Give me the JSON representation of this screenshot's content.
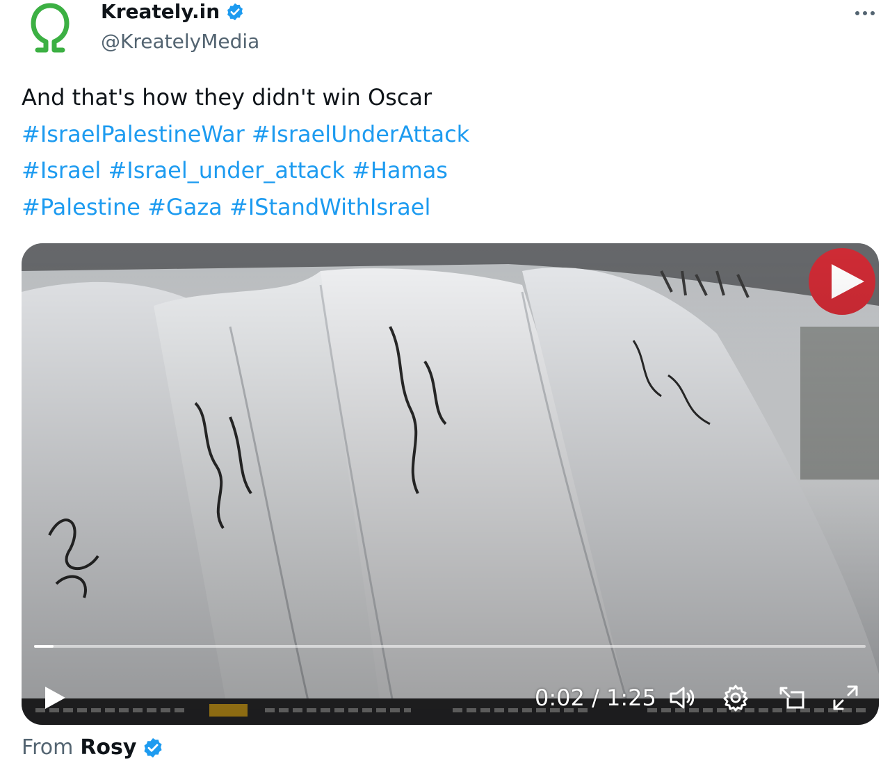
{
  "author": {
    "display_name": "Kreately.in",
    "handle": "@KreatelyMedia",
    "verified": true,
    "avatar_icon": "omega-logo",
    "avatar_color": "#3cb043"
  },
  "menu": {
    "icon": "more-options-icon"
  },
  "tweet": {
    "lines": [
      [
        {
          "text": "And that's how they didn't win Oscar",
          "type": "text"
        }
      ],
      [
        {
          "text": "#IsraelPalestineWar",
          "type": "hashtag"
        },
        {
          "text": " ",
          "type": "text"
        },
        {
          "text": "#IsraelUnderAttack",
          "type": "hashtag"
        }
      ],
      [
        {
          "text": "#Israel",
          "type": "hashtag"
        },
        {
          "text": " ",
          "type": "text"
        },
        {
          "text": "#Israel_under_attack",
          "type": "hashtag"
        },
        {
          "text": " ",
          "type": "text"
        },
        {
          "text": "#Hamas",
          "type": "hashtag"
        }
      ],
      [
        {
          "text": "#Palestine",
          "type": "hashtag"
        },
        {
          "text": " ",
          "type": "text"
        },
        {
          "text": "#Gaza",
          "type": "hashtag"
        },
        {
          "text": " ",
          "type": "text"
        },
        {
          "text": "#IStandWithIsrael",
          "type": "hashtag"
        }
      ]
    ]
  },
  "video": {
    "current_time": "0:02",
    "duration": "1:25",
    "time_display": "0:02 / 1:25",
    "progress": 0.0235,
    "controls": [
      "play-icon",
      "volume-icon",
      "settings-icon",
      "pip-icon",
      "fullscreen-icon"
    ]
  },
  "footer": {
    "from_label": "From",
    "from_name": "Rosy",
    "verified": true
  },
  "colors": {
    "hashtag": "#1d9bf0",
    "verified_badge": "#1d9bf0",
    "secondary_text": "#536471",
    "primary_text": "#0f1419"
  }
}
